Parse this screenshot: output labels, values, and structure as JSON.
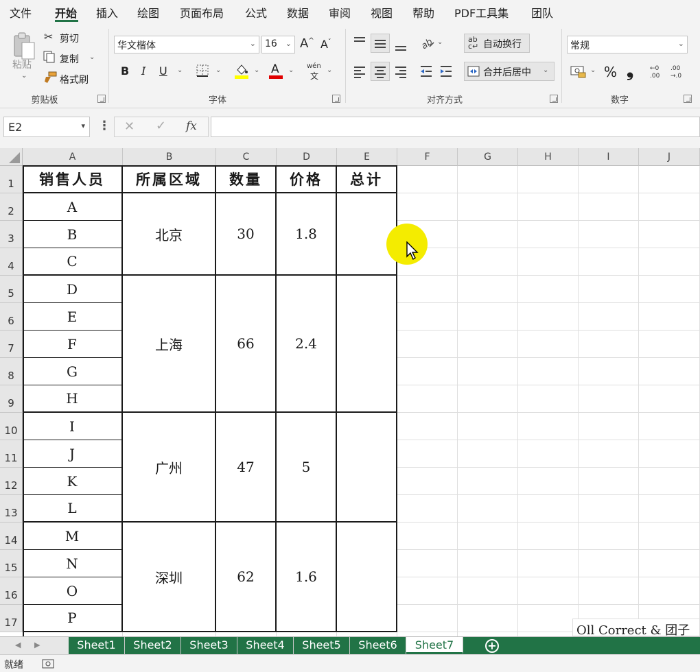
{
  "menu": {
    "items": [
      "文件",
      "开始",
      "插入",
      "绘图",
      "页面布局",
      "公式",
      "数据",
      "审阅",
      "视图",
      "帮助",
      "PDF工具集",
      "团队"
    ],
    "active_index": 1
  },
  "ribbon": {
    "clipboard": {
      "paste_label": "粘贴",
      "cut_label": "剪切",
      "copy_label": "复制",
      "format_painter_label": "格式刷",
      "group_label": "剪贴板"
    },
    "font": {
      "font_name": "华文楷体",
      "font_size": "16",
      "bold_label": "B",
      "italic_label": "I",
      "underline_label": "U",
      "phonetic_label": "wén",
      "phonetic_sub": "文",
      "group_label": "字体",
      "fill_color": "#ffff00",
      "font_color": "#e00000"
    },
    "alignment": {
      "wrap_text_label": "自动换行",
      "merge_center_label": "合并后居中",
      "group_label": "对齐方式"
    },
    "number": {
      "format": "常规",
      "percent_label": "%",
      "comma_label": "❟",
      "group_label": "数字"
    }
  },
  "formula_bar": {
    "name_box": "E2",
    "fx_label": "fx",
    "formula": ""
  },
  "columns": [
    "A",
    "B",
    "C",
    "D",
    "E",
    "F",
    "G",
    "H",
    "I",
    "J"
  ],
  "rows": [
    "1",
    "2",
    "3",
    "4",
    "5",
    "6",
    "7",
    "8",
    "9",
    "10",
    "11",
    "12",
    "13",
    "14",
    "15",
    "16",
    "17"
  ],
  "table": {
    "headers": [
      "销售人员",
      "所属区域",
      "数量",
      "价格",
      "总计"
    ],
    "salespeople": [
      "A",
      "B",
      "C",
      "D",
      "E",
      "F",
      "G",
      "H",
      "I",
      "J",
      "K",
      "L",
      "M",
      "N",
      "O",
      "P"
    ],
    "regions": [
      {
        "name": "北京",
        "quantity": "30",
        "price": "1.8",
        "total": ""
      },
      {
        "name": "上海",
        "quantity": "66",
        "price": "2.4",
        "total": ""
      },
      {
        "name": "广州",
        "quantity": "47",
        "price": "5",
        "total": ""
      },
      {
        "name": "深圳",
        "quantity": "62",
        "price": "1.6",
        "total": ""
      }
    ]
  },
  "sheets": {
    "tabs": [
      "Sheet1",
      "Sheet2",
      "Sheet3",
      "Sheet4",
      "Sheet5",
      "Sheet6",
      "Sheet7"
    ],
    "active": "Sheet7",
    "add_label": "+"
  },
  "status": {
    "ready": "就绪"
  },
  "watermark": "Oll Correct & 团子",
  "colors": {
    "accent": "#217346",
    "cursor_highlight": "#f4ec00"
  }
}
